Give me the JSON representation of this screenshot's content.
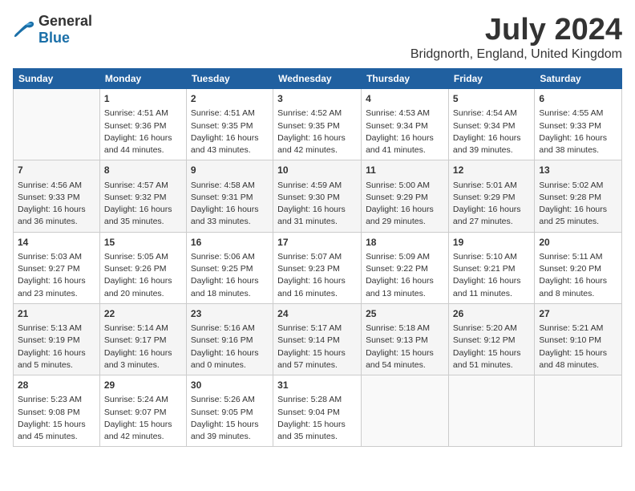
{
  "logo": {
    "general": "General",
    "blue": "Blue"
  },
  "title": "July 2024",
  "location": "Bridgnorth, England, United Kingdom",
  "weekdays": [
    "Sunday",
    "Monday",
    "Tuesday",
    "Wednesday",
    "Thursday",
    "Friday",
    "Saturday"
  ],
  "weeks": [
    [
      {
        "day": "",
        "content": ""
      },
      {
        "day": "1",
        "content": "Sunrise: 4:51 AM\nSunset: 9:36 PM\nDaylight: 16 hours\nand 44 minutes."
      },
      {
        "day": "2",
        "content": "Sunrise: 4:51 AM\nSunset: 9:35 PM\nDaylight: 16 hours\nand 43 minutes."
      },
      {
        "day": "3",
        "content": "Sunrise: 4:52 AM\nSunset: 9:35 PM\nDaylight: 16 hours\nand 42 minutes."
      },
      {
        "day": "4",
        "content": "Sunrise: 4:53 AM\nSunset: 9:34 PM\nDaylight: 16 hours\nand 41 minutes."
      },
      {
        "day": "5",
        "content": "Sunrise: 4:54 AM\nSunset: 9:34 PM\nDaylight: 16 hours\nand 39 minutes."
      },
      {
        "day": "6",
        "content": "Sunrise: 4:55 AM\nSunset: 9:33 PM\nDaylight: 16 hours\nand 38 minutes."
      }
    ],
    [
      {
        "day": "7",
        "content": "Sunrise: 4:56 AM\nSunset: 9:33 PM\nDaylight: 16 hours\nand 36 minutes."
      },
      {
        "day": "8",
        "content": "Sunrise: 4:57 AM\nSunset: 9:32 PM\nDaylight: 16 hours\nand 35 minutes."
      },
      {
        "day": "9",
        "content": "Sunrise: 4:58 AM\nSunset: 9:31 PM\nDaylight: 16 hours\nand 33 minutes."
      },
      {
        "day": "10",
        "content": "Sunrise: 4:59 AM\nSunset: 9:30 PM\nDaylight: 16 hours\nand 31 minutes."
      },
      {
        "day": "11",
        "content": "Sunrise: 5:00 AM\nSunset: 9:29 PM\nDaylight: 16 hours\nand 29 minutes."
      },
      {
        "day": "12",
        "content": "Sunrise: 5:01 AM\nSunset: 9:29 PM\nDaylight: 16 hours\nand 27 minutes."
      },
      {
        "day": "13",
        "content": "Sunrise: 5:02 AM\nSunset: 9:28 PM\nDaylight: 16 hours\nand 25 minutes."
      }
    ],
    [
      {
        "day": "14",
        "content": "Sunrise: 5:03 AM\nSunset: 9:27 PM\nDaylight: 16 hours\nand 23 minutes."
      },
      {
        "day": "15",
        "content": "Sunrise: 5:05 AM\nSunset: 9:26 PM\nDaylight: 16 hours\nand 20 minutes."
      },
      {
        "day": "16",
        "content": "Sunrise: 5:06 AM\nSunset: 9:25 PM\nDaylight: 16 hours\nand 18 minutes."
      },
      {
        "day": "17",
        "content": "Sunrise: 5:07 AM\nSunset: 9:23 PM\nDaylight: 16 hours\nand 16 minutes."
      },
      {
        "day": "18",
        "content": "Sunrise: 5:09 AM\nSunset: 9:22 PM\nDaylight: 16 hours\nand 13 minutes."
      },
      {
        "day": "19",
        "content": "Sunrise: 5:10 AM\nSunset: 9:21 PM\nDaylight: 16 hours\nand 11 minutes."
      },
      {
        "day": "20",
        "content": "Sunrise: 5:11 AM\nSunset: 9:20 PM\nDaylight: 16 hours\nand 8 minutes."
      }
    ],
    [
      {
        "day": "21",
        "content": "Sunrise: 5:13 AM\nSunset: 9:19 PM\nDaylight: 16 hours\nand 5 minutes."
      },
      {
        "day": "22",
        "content": "Sunrise: 5:14 AM\nSunset: 9:17 PM\nDaylight: 16 hours\nand 3 minutes."
      },
      {
        "day": "23",
        "content": "Sunrise: 5:16 AM\nSunset: 9:16 PM\nDaylight: 16 hours\nand 0 minutes."
      },
      {
        "day": "24",
        "content": "Sunrise: 5:17 AM\nSunset: 9:14 PM\nDaylight: 15 hours\nand 57 minutes."
      },
      {
        "day": "25",
        "content": "Sunrise: 5:18 AM\nSunset: 9:13 PM\nDaylight: 15 hours\nand 54 minutes."
      },
      {
        "day": "26",
        "content": "Sunrise: 5:20 AM\nSunset: 9:12 PM\nDaylight: 15 hours\nand 51 minutes."
      },
      {
        "day": "27",
        "content": "Sunrise: 5:21 AM\nSunset: 9:10 PM\nDaylight: 15 hours\nand 48 minutes."
      }
    ],
    [
      {
        "day": "28",
        "content": "Sunrise: 5:23 AM\nSunset: 9:08 PM\nDaylight: 15 hours\nand 45 minutes."
      },
      {
        "day": "29",
        "content": "Sunrise: 5:24 AM\nSunset: 9:07 PM\nDaylight: 15 hours\nand 42 minutes."
      },
      {
        "day": "30",
        "content": "Sunrise: 5:26 AM\nSunset: 9:05 PM\nDaylight: 15 hours\nand 39 minutes."
      },
      {
        "day": "31",
        "content": "Sunrise: 5:28 AM\nSunset: 9:04 PM\nDaylight: 15 hours\nand 35 minutes."
      },
      {
        "day": "",
        "content": ""
      },
      {
        "day": "",
        "content": ""
      },
      {
        "day": "",
        "content": ""
      }
    ]
  ]
}
